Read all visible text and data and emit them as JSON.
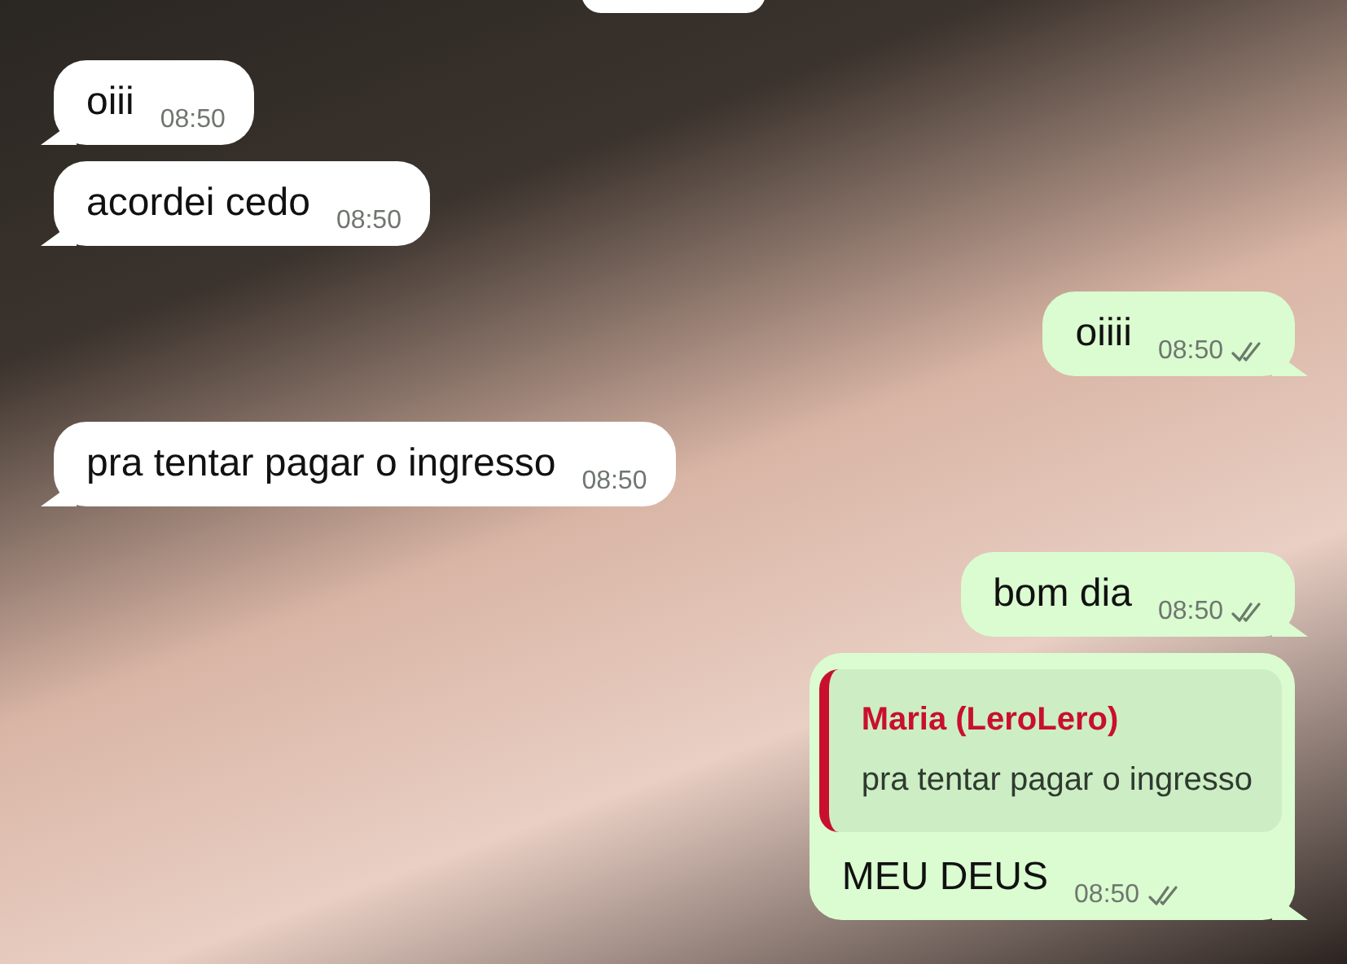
{
  "messages": [
    {
      "outgoing": false,
      "text": "oiii",
      "time": "08:50"
    },
    {
      "outgoing": false,
      "text": "acordei cedo",
      "time": "08:50"
    },
    {
      "outgoing": true,
      "text": "oiiii",
      "time": "08:50",
      "read": false
    },
    {
      "outgoing": false,
      "text": "pra tentar pagar o ingresso",
      "time": "08:50"
    },
    {
      "outgoing": true,
      "text": "bom dia",
      "time": "08:50",
      "read": false
    },
    {
      "outgoing": true,
      "text": "MEU DEUS",
      "time": "08:50",
      "read": false,
      "reply": {
        "author": "Maria (LeroLero)",
        "text": "pra tentar pagar o ingresso"
      }
    }
  ]
}
